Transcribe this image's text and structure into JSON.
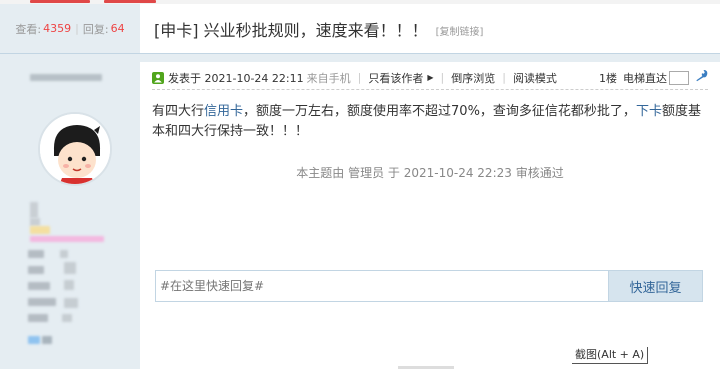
{
  "sidebar": {
    "views_label": "查看:",
    "views_count": "4359",
    "replies_label": "回复:",
    "replies_count": "64"
  },
  "thread": {
    "title": "[申卡] 兴业秒批规则，速度来看！！！",
    "copy_link": "[复制链接]"
  },
  "post_meta": {
    "posted_label": "发表于 2021-10-24 22:11",
    "source": "来自手机",
    "only_author": "只看该作者",
    "reverse_browse": "倒序浏览",
    "read_mode": "阅读模式",
    "floor": "1楼",
    "elevator": "电梯直达"
  },
  "post": {
    "text_a": "有四大行",
    "link_card": "信用卡",
    "text_b": "，额度一万左右，额度使用率不超过70%，查询多征信花都秒批了，",
    "link_xiaka": "下卡",
    "text_c": "额度基本和四大行保持一致！！！"
  },
  "audit_notice": "本主题由 管理员 于 2021-10-24 22:23 审核通过",
  "quick_reply": {
    "placeholder": "#在这里快速回复#",
    "button": "快速回复"
  },
  "screenshot_tooltip": "截图(Alt + A)"
}
